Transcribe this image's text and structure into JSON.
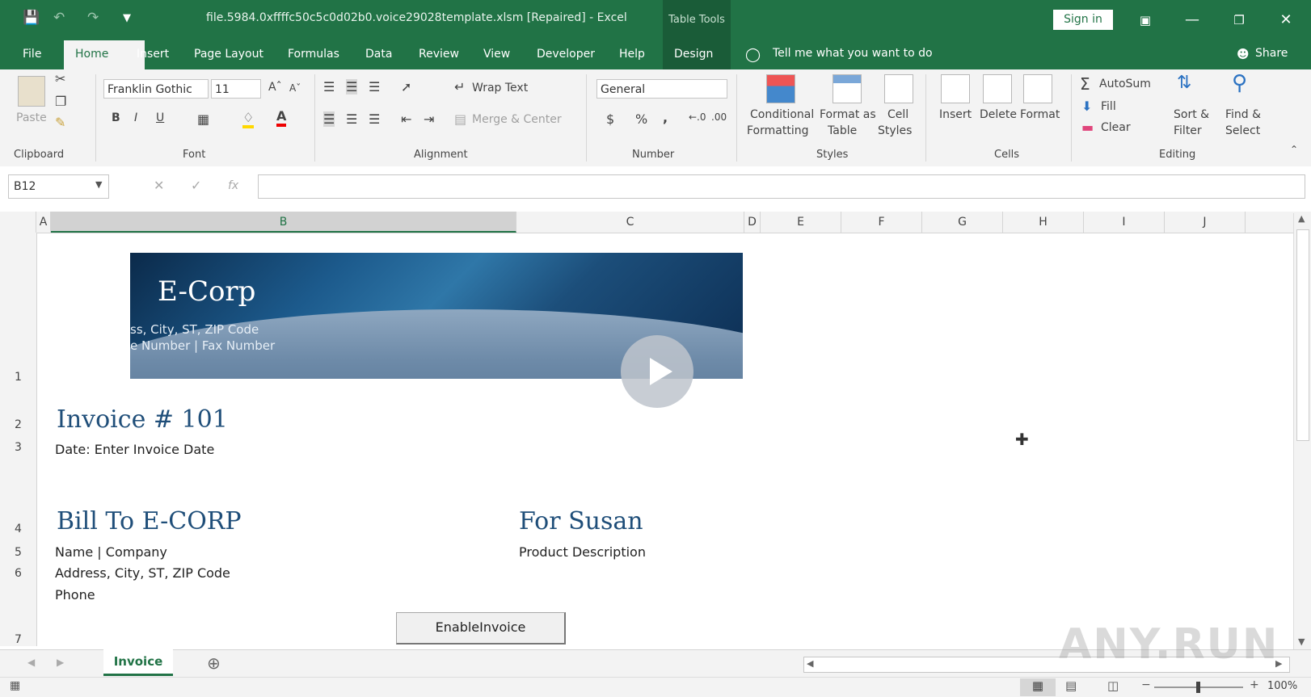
{
  "window": {
    "title": "file.5984.0xffffc50c5c0d02b0.voice29028template.xlsm [Repaired]  -  Excel",
    "table_tools": "Table Tools",
    "sign_in": "Sign in"
  },
  "ribbon_tabs": [
    "File",
    "Home",
    "Insert",
    "Page Layout",
    "Formulas",
    "Data",
    "Review",
    "View",
    "Developer",
    "Help",
    "Design"
  ],
  "tell_me": "Tell me what you want to do",
  "share": "Share",
  "clipboard": {
    "paste": "Paste",
    "group": "Clipboard"
  },
  "font": {
    "name": "Franklin Gothic",
    "size": "11",
    "group": "Font",
    "bold": "B",
    "italic": "I",
    "underline": "U"
  },
  "alignment": {
    "wrap_text": "Wrap Text",
    "merge_center": "Merge & Center",
    "group": "Alignment"
  },
  "number": {
    "format": "General",
    "currency": "$",
    "percent": "%",
    "comma": ",",
    "group": "Number"
  },
  "styles": {
    "conditional": [
      "Conditional",
      "Formatting"
    ],
    "format_as": [
      "Format as",
      "Table"
    ],
    "cell": [
      "Cell",
      "Styles"
    ],
    "group": "Styles"
  },
  "cells": {
    "insert": "Insert",
    "delete": "Delete",
    "format": "Format",
    "group": "Cells"
  },
  "editing": {
    "autosum": "AutoSum",
    "fill": "Fill",
    "clear": "Clear",
    "sort": [
      "Sort &",
      "Filter"
    ],
    "find": [
      "Find &",
      "Select"
    ],
    "group": "Editing"
  },
  "formula_bar": {
    "name_box": "B12",
    "fx": "fx",
    "value": ""
  },
  "columns": [
    "A",
    "B",
    "C",
    "D",
    "E",
    "F",
    "G",
    "H",
    "I",
    "J"
  ],
  "rows": [
    "1",
    "2",
    "3",
    "4",
    "5",
    "6",
    "7"
  ],
  "sheet": {
    "banner_title": "E-Corp",
    "banner_line1": "ss, City, ST, ZIP Code",
    "banner_line2": "e Number | Fax Number",
    "invoice_title": "Invoice # 101",
    "date": "Date: Enter Invoice Date",
    "bill_to": "Bill To E-CORP",
    "for": "For Susan",
    "name_company": "Name | Company",
    "address": "Address, City, ST, ZIP Code",
    "phone": "Phone",
    "product_desc": "Product Description",
    "enable_button": "EnableInvoice"
  },
  "sheet_tab": "Invoice",
  "zoom": "100%",
  "watermark": "ANY.RUN"
}
